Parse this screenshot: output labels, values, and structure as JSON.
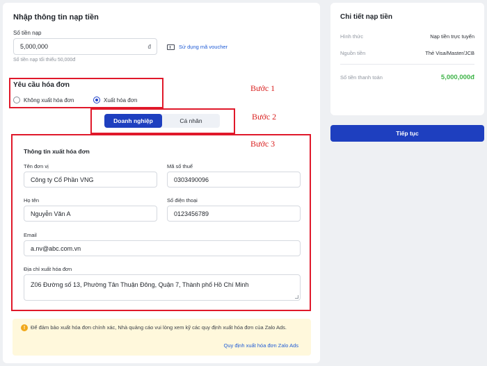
{
  "topup": {
    "title": "Nhập thông tin nạp tiền",
    "amount_label": "Số tiền nạp",
    "amount_value": "5,000,000",
    "currency_suffix": "đ",
    "min_hint": "Số tiền nạp tối thiểu 50,000đ",
    "voucher_link": "Sử dụng mã voucher"
  },
  "invoice_request": {
    "title": "Yêu cầu hóa đơn",
    "option_no": "Không xuất hóa đơn",
    "option_yes": "Xuất hóa đơn",
    "selected": "Xuất hóa đơn"
  },
  "entity_tabs": {
    "business": "Doanh nghiệp",
    "individual": "Cá nhân",
    "active": "Doanh nghiệp"
  },
  "invoice_form": {
    "title": "Thông tin xuất hóa đơn",
    "company_label": "Tên đơn vị",
    "company_value": "Công ty Cổ Phần VNG",
    "tax_label": "Mã số thuế",
    "tax_value": "0303490096",
    "name_label": "Họ tên",
    "name_value": "Nguyễn Văn A",
    "phone_label": "Số điện thoại",
    "phone_value": "0123456789",
    "email_label": "Email",
    "email_value": "a.nv@abc.com.vn",
    "address_label": "Địa chỉ xuất hóa đơn",
    "address_value": "Z06 Đường số 13, Phường Tân Thuận Đông, Quận 7, Thành phố Hồ Chí Minh"
  },
  "notice": {
    "text": "Để đảm bảo xuất hóa đơn chính xác, Nhà quảng cáo vui lòng xem kỹ các quy định xuất hóa đơn của Zalo Ads.",
    "link": "Quy định xuất hóa đơn Zalo Ads"
  },
  "annotations": {
    "step1": "Bước 1",
    "step2": "Bước 2",
    "step3": "Bước 3",
    "color": "#e0182a"
  },
  "summary": {
    "title": "Chi tiết nạp tiền",
    "method_label": "Hình thức",
    "method_value": "Nạp tiền trực tuyến",
    "source_label": "Nguồn tiền",
    "source_value": "Thẻ Visa/Master/JCB",
    "total_label": "Số tiền thanh toán",
    "total_value": "5,000,000đ",
    "continue_button": "Tiếp tục"
  },
  "colors": {
    "primary": "#1e3fbf",
    "link": "#1e5bd6",
    "amount": "#3fb449",
    "notice_bg": "#fff8dc"
  }
}
